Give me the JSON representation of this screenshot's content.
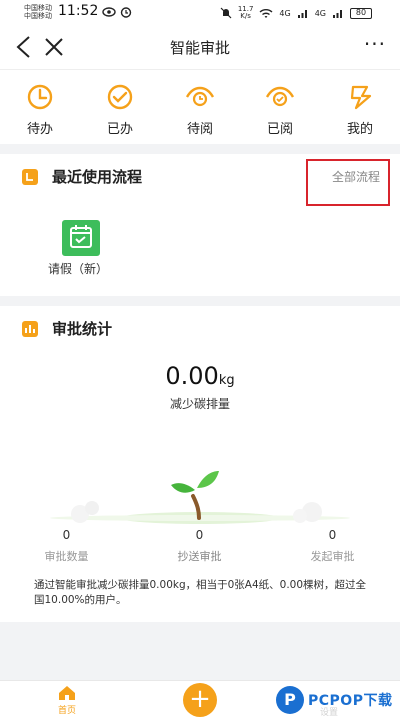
{
  "status_bar": {
    "carrier_1": "中国移动",
    "carrier_2": "中国移动",
    "time": "11:52",
    "net_speed": "11.7",
    "net_unit": "K/s",
    "sig_1": "4G",
    "sig_2": "4G",
    "battery": "80"
  },
  "nav": {
    "title": "智能审批",
    "more": "···"
  },
  "quick_actions": [
    {
      "label": "待办",
      "icon": "clock-icon"
    },
    {
      "label": "已办",
      "icon": "check-clock-icon"
    },
    {
      "label": "待阅",
      "icon": "eye-clock-icon"
    },
    {
      "label": "已阅",
      "icon": "eye-check-icon"
    },
    {
      "label": "我的",
      "icon": "user-doc-icon"
    }
  ],
  "recent": {
    "title": "最近使用流程",
    "all_link": "全部流程",
    "flows": [
      {
        "label": "请假（新）",
        "icon": "calendar-check-icon"
      }
    ]
  },
  "stats": {
    "title": "审批统计",
    "carbon_value": "0.00",
    "carbon_unit": "kg",
    "carbon_label": "减少碳排量",
    "columns": [
      {
        "value": "0",
        "label": "审批数量"
      },
      {
        "value": "0",
        "label": "抄送审批"
      },
      {
        "value": "0",
        "label": "发起审批"
      }
    ],
    "note": "通过智能审批减少碳排量0.00kg，相当于0张A4纸、0.00棵树，超过全国10.00%的用户。"
  },
  "tabbar": {
    "home_label": "首页",
    "add_label": "+",
    "settings_label": "设置"
  },
  "watermark": {
    "logo_letter": "P",
    "text": "PCPOP下载"
  },
  "colors": {
    "accent": "#f5a11a",
    "flow_green": "#3dbd5b",
    "highlight_red": "#d8242c"
  }
}
